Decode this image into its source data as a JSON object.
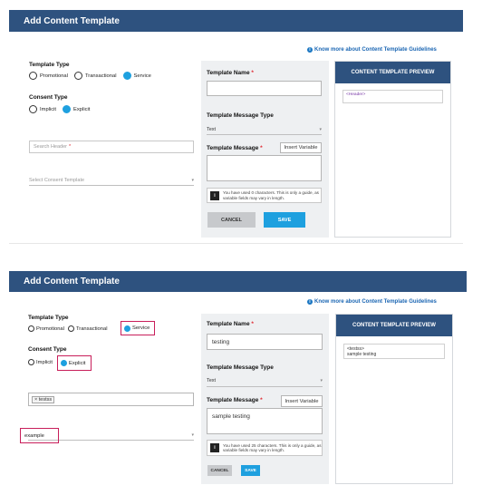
{
  "panel1": {
    "title": "Add Content Template",
    "guidelines_link": "Know more about Content Template Guidelines",
    "template_type": {
      "label": "Template Type",
      "options": [
        "Promotional",
        "Transactional",
        "Service"
      ],
      "selected": "Service"
    },
    "consent_type": {
      "label": "Consent Type",
      "options": [
        "Implicit",
        "Explicit"
      ],
      "selected": "Explicit"
    },
    "search_header": {
      "placeholder": "Search Header",
      "required": "*"
    },
    "select_consent": {
      "placeholder": "Select Consent Template"
    },
    "template_name": {
      "label": "Template Name",
      "required": "*",
      "value": ""
    },
    "message_type": {
      "label": "Template Message Type",
      "value": "Text"
    },
    "template_message": {
      "label": "Template Message",
      "required": "*",
      "value": "",
      "insert_variable": "Insert Variable"
    },
    "info_text": "You have used 0 characters. This is only a guide, as variable fields may vary in length.",
    "cancel_label": "CANCEL",
    "save_label": "SAVE",
    "preview": {
      "title": "CONTENT TEMPLATE PREVIEW",
      "header_tag": "<Header>",
      "body": ""
    }
  },
  "panel2": {
    "title": "Add Content Template",
    "guidelines_link": "Know more about Content Template Guidelines",
    "template_type": {
      "label": "Template Type",
      "options": [
        "Promotional",
        "Transactional",
        "Service"
      ],
      "selected": "Service"
    },
    "consent_type": {
      "label": "Consent Type",
      "options": [
        "Implicit",
        "Explicit"
      ],
      "selected": "Explicit"
    },
    "header_chip": "testss",
    "select_consent": {
      "value": "example"
    },
    "template_name": {
      "label": "Template Name",
      "required": "*",
      "value": "testing"
    },
    "message_type": {
      "label": "Template Message Type",
      "value": "Text"
    },
    "template_message": {
      "label": "Template Message",
      "required": "*",
      "value": "sample testing",
      "insert_variable": "Insert Variable"
    },
    "info_text": "You have used 25 characters. This is only a guide, as variable fields may vary in length.",
    "cancel_label": "CANCEL",
    "save_label": "SAVE",
    "preview": {
      "title": "CONTENT TEMPLATE PREVIEW",
      "header_tag": "<testss>",
      "body": "sample testing"
    }
  },
  "colors": {
    "header": "#2e527f",
    "accent": "#1ea0df",
    "link": "#1b66b3",
    "highlight": "#c81e5a"
  }
}
